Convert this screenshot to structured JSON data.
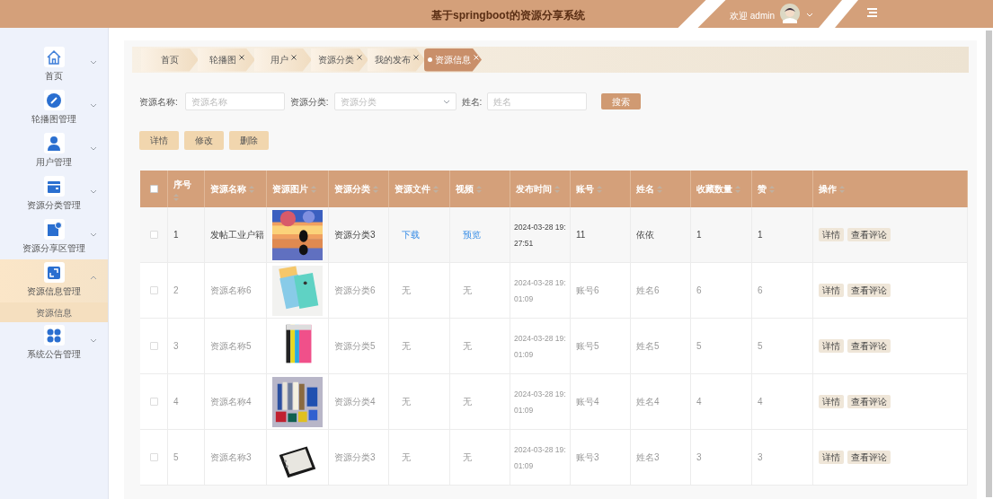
{
  "header": {
    "title": "基于springboot的资源分享系统",
    "welcome": "欢迎 admin"
  },
  "sidebar": {
    "items": [
      {
        "label": "首页",
        "expanded": false,
        "selected": false
      },
      {
        "label": "轮播图管理",
        "expanded": false,
        "selected": false
      },
      {
        "label": "用户管理",
        "expanded": false,
        "selected": false
      },
      {
        "label": "资源分类管理",
        "expanded": false,
        "selected": false
      },
      {
        "label": "资源分享区管理",
        "expanded": false,
        "selected": false
      },
      {
        "label": "资源信息管理",
        "expanded": true,
        "selected": true,
        "children": [
          {
            "label": "资源信息",
            "selected": true
          }
        ]
      },
      {
        "label": "系统公告管理",
        "expanded": false,
        "selected": false
      }
    ]
  },
  "tabs": [
    {
      "label": "首页",
      "selected": false,
      "closable": false
    },
    {
      "label": "轮播图",
      "selected": false,
      "closable": true
    },
    {
      "label": "用户",
      "selected": false,
      "closable": true
    },
    {
      "label": "资源分类",
      "selected": false,
      "closable": true
    },
    {
      "label": "我的发布",
      "selected": false,
      "closable": true
    },
    {
      "label": "资源信息",
      "selected": true,
      "closable": true
    }
  ],
  "search": {
    "fields": [
      {
        "label": "资源名称:",
        "placeholder": "资源名称",
        "kind": "text"
      },
      {
        "label": "资源分类:",
        "placeholder": "资源分类",
        "kind": "select"
      },
      {
        "label": "姓名:",
        "placeholder": "姓名",
        "kind": "text"
      }
    ],
    "button": "搜索"
  },
  "action_buttons": [
    "详情",
    "修改",
    "删除"
  ],
  "table": {
    "header_checkbox": {
      "checked": false
    },
    "columns": [
      {
        "label": "序号",
        "sortable": true
      },
      {
        "label": "资源名称",
        "sortable": true
      },
      {
        "label": "资源图片",
        "sortable": true
      },
      {
        "label": "资源分类",
        "sortable": true
      },
      {
        "label": "资源文件",
        "sortable": true
      },
      {
        "label": "视频",
        "sortable": true
      },
      {
        "label": "发布时间",
        "sortable": true
      },
      {
        "label": "账号",
        "sortable": true
      },
      {
        "label": "姓名",
        "sortable": true
      },
      {
        "label": "收藏数量",
        "sortable": true
      },
      {
        "label": "赞",
        "sortable": true
      },
      {
        "label": "操作",
        "sortable": true
      }
    ],
    "rows": [
      {
        "checked": false,
        "highlighted": true,
        "index": "1",
        "name": "发帖工业户籍",
        "image": {
          "kind": "picture"
        },
        "category": "资源分类3",
        "file": {
          "text": "下载",
          "link": true
        },
        "video": {
          "text": "预览",
          "link": true
        },
        "time": "2024-03-28 19:27:51",
        "account": "11",
        "person": "依依",
        "favorites": "1",
        "likes": "1",
        "actions": [
          "详情",
          "查看评论"
        ]
      },
      {
        "checked": false,
        "highlighted": false,
        "index": "2",
        "name": "资源名称6",
        "image": {
          "kind": "picture"
        },
        "category": "资源分类6",
        "file": {
          "text": "无",
          "link": false
        },
        "video": {
          "text": "无",
          "link": false
        },
        "time": "2024-03-28 19:01:09",
        "account": "账号6",
        "person": "姓名6",
        "favorites": "6",
        "likes": "6",
        "actions": [
          "详情",
          "查看评论"
        ]
      },
      {
        "checked": false,
        "highlighted": false,
        "index": "3",
        "name": "资源名称5",
        "image": {
          "kind": "picture"
        },
        "category": "资源分类5",
        "file": {
          "text": "无",
          "link": false
        },
        "video": {
          "text": "无",
          "link": false
        },
        "time": "2024-03-28 19:01:09",
        "account": "账号5",
        "person": "姓名5",
        "favorites": "5",
        "likes": "5",
        "actions": [
          "详情",
          "查看评论"
        ]
      },
      {
        "checked": false,
        "highlighted": false,
        "index": "4",
        "name": "资源名称4",
        "image": {
          "kind": "picture"
        },
        "category": "资源分类4",
        "file": {
          "text": "无",
          "link": false
        },
        "video": {
          "text": "无",
          "link": false
        },
        "time": "2024-03-28 19:01:09",
        "account": "账号4",
        "person": "姓名4",
        "favorites": "4",
        "likes": "4",
        "actions": [
          "详情",
          "查看评论"
        ]
      },
      {
        "checked": false,
        "highlighted": false,
        "index": "5",
        "name": "资源名称3",
        "image": {
          "kind": "picture"
        },
        "category": "资源分类3",
        "file": {
          "text": "无",
          "link": false
        },
        "video": {
          "text": "无",
          "link": false
        },
        "time": "2024-03-28 19:01:09",
        "account": "账号3",
        "person": "姓名3",
        "favorites": "3",
        "likes": "3",
        "actions": [
          "详情",
          "查看评论"
        ]
      }
    ]
  }
}
